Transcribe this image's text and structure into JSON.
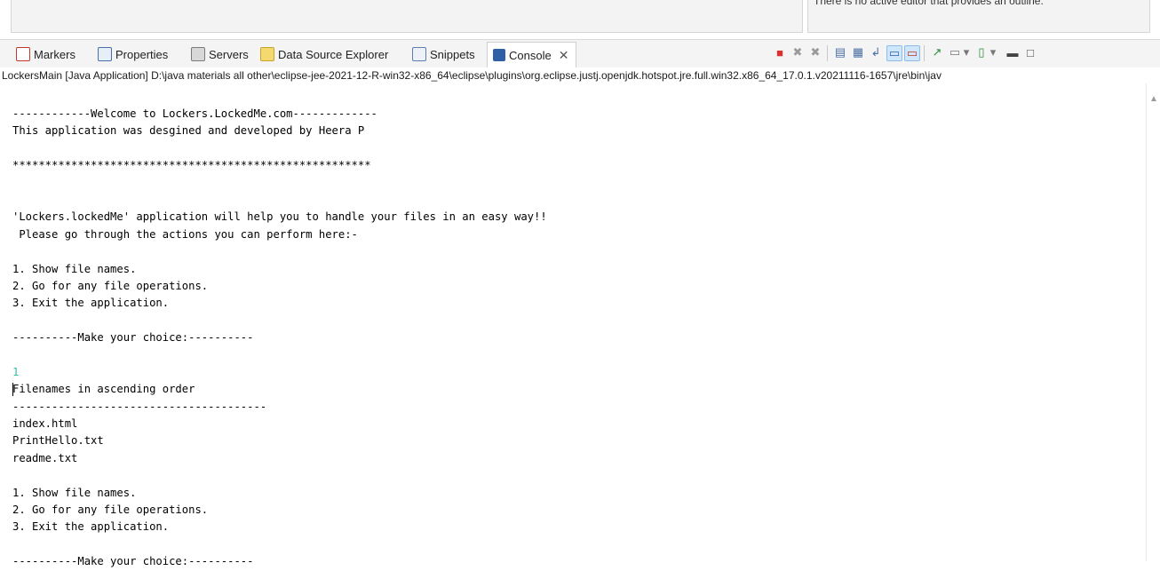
{
  "outline_panel": {
    "message": "There is no active editor that provides an outline."
  },
  "tabs": [
    {
      "label": "Markers",
      "icon": "markers-icon",
      "color": "#c0392b"
    },
    {
      "label": "Properties",
      "icon": "properties-icon",
      "color": "#4a6fa5"
    },
    {
      "label": "Servers",
      "icon": "servers-icon",
      "color": "#7a7a7a"
    },
    {
      "label": "Data Source Explorer",
      "icon": "data-source-icon",
      "color": "#c9a227"
    },
    {
      "label": "Snippets",
      "icon": "snippets-icon",
      "color": "#5b7fa8"
    },
    {
      "label": "Console",
      "icon": "console-icon",
      "color": "#2f5fa7",
      "active": true
    }
  ],
  "toolbar": {
    "terminate": "■",
    "remove_launch": "✖",
    "remove_all": "✖",
    "clear_console": "▤",
    "scroll_lock": "▦",
    "word_wrap": "↲",
    "show_stdout": "▭",
    "show_stderr": "▭",
    "pin_console": "↗",
    "display_selected": "▭",
    "open_console": "▯",
    "minimize": "▬",
    "maximize": "□",
    "dropdown": "▾"
  },
  "launch_path": "LockersMain [Java Application] D:\\java materials all other\\eclipse-jee-2021-12-R-win32-x86_64\\eclipse\\plugins\\org.eclipse.justj.openjdk.hotspot.jre.full.win32.x86_64_17.0.1.v20211116-1657\\jre\\bin\\jav",
  "console_lines": [
    "------------Welcome to Lockers.LockedMe.com-------------",
    "This application was desgined and developed by Heera P",
    "",
    "*******************************************************",
    "",
    "",
    "'Lockers.lockedMe' application will help you to handle your files in an easy way!!",
    " Please go through the actions you can perform here:-",
    "",
    "1. Show file names.",
    "2. Go for any file operations.",
    "3. Exit the application.",
    "",
    "----------Make your choice:----------",
    "",
    "1",
    "Filenames in ascending order",
    "---------------------------------------",
    "index.html",
    "PrintHello.txt",
    "readme.txt",
    "",
    "1. Show file names.",
    "2. Go for any file operations.",
    "3. Exit the application.",
    "",
    "----------Make your choice:----------"
  ],
  "input_line_index": 15,
  "colors": {
    "input_text": "#2fbfa6",
    "terminate": "#e02f2f"
  }
}
